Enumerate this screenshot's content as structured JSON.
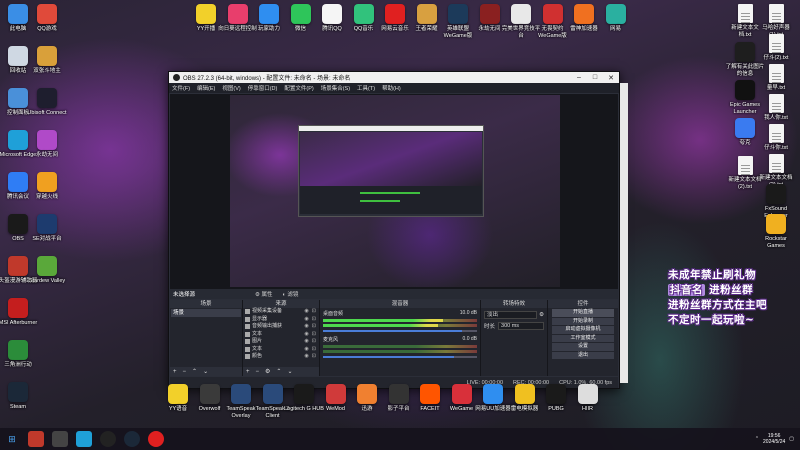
{
  "desktop": {
    "left_col": [
      {
        "label": "此电脑",
        "icon": "computer-icon",
        "color": "#3a8ee6"
      },
      {
        "label": "回收站",
        "icon": "recycle-bin-icon",
        "color": "#cfd8e3"
      },
      {
        "label": "控制面板",
        "icon": "control-panel-icon",
        "color": "#4a90d9"
      },
      {
        "label": "Microsoft Edge",
        "icon": "edge-icon",
        "color": "#1fa0d8"
      },
      {
        "label": "腾讯会议",
        "icon": "tencent-meeting-icon",
        "color": "#2f7df5"
      },
      {
        "label": "OBS",
        "icon": "obs-icon",
        "color": "#1a1a1a"
      },
      {
        "label": "头盔漫游辅助器",
        "icon": "helmet-icon",
        "color": "#c0392b"
      },
      {
        "label": "MSI Afterburner",
        "icon": "msi-icon",
        "color": "#c41e1e"
      },
      {
        "label": "三角洲行动",
        "icon": "delta-icon",
        "color": "#2b8c3a"
      },
      {
        "label": "Steam",
        "icon": "steam-icon",
        "color": "#1b2838"
      }
    ],
    "second_col": [
      {
        "label": "QQ游戏",
        "icon": "qq-game-icon",
        "color": "#e04a3a"
      },
      {
        "label": "双张斗地主",
        "icon": "doudizhu-icon",
        "color": "#d9a03a"
      },
      {
        "label": "Ubisoft Connect",
        "icon": "ubisoft-icon",
        "color": "#1e1e2e"
      },
      {
        "label": "永劫无间",
        "icon": "naraka-icon",
        "color": "#b04ac8"
      },
      {
        "label": "穿越火线",
        "icon": "crossfire-icon",
        "color": "#f0a020"
      },
      {
        "label": "SE对战平台",
        "icon": "se-platform-icon",
        "color": "#1d3b6e"
      },
      {
        "label": "Stardew Valley",
        "icon": "stardew-icon",
        "color": "#5aa83a"
      }
    ],
    "top_row": [
      {
        "label": "YY开播",
        "icon": "yy-icon",
        "color": "#f2d02a"
      },
      {
        "label": "向日葵远程控制",
        "icon": "sunflower-icon",
        "color": "#e83e6c"
      },
      {
        "label": "玩家助力",
        "icon": "player-help-icon",
        "color": "#2f8ef0"
      },
      {
        "label": "微信",
        "icon": "wechat-icon",
        "color": "#2ec55a"
      },
      {
        "label": "腾讯QQ",
        "icon": "qq-icon",
        "color": "#f5f5f5"
      },
      {
        "label": "QQ音乐",
        "icon": "qq-music-icon",
        "color": "#31c27c"
      },
      {
        "label": "网易云音乐",
        "icon": "netease-music-icon",
        "color": "#e02020"
      },
      {
        "label": "王者荣耀",
        "icon": "honor-of-kings-icon",
        "color": "#d8a040"
      },
      {
        "label": "英雄联盟WeGame版",
        "icon": "lol-icon",
        "color": "#1c3a5a"
      },
      {
        "label": "永劫无间",
        "icon": "naraka2-icon",
        "color": "#8a2020"
      },
      {
        "label": "完美世界竞技平台",
        "icon": "perfect-world-icon",
        "color": "#e8e8e8"
      },
      {
        "label": "无畏契约WeGame版",
        "icon": "valorant-icon",
        "color": "#d03030"
      },
      {
        "label": "雷神加速器",
        "icon": "leishen-icon",
        "color": "#f07020"
      },
      {
        "label": "网易",
        "icon": "netease-icon",
        "color": "#2ab0a0"
      }
    ],
    "right_col": [
      {
        "label": "新建文本文档.txt",
        "icon": "txt-file-icon"
      },
      {
        "label": "了解有关此图片的信息",
        "icon": "info-icon",
        "color": "#1e1e1e"
      },
      {
        "label": "Epic Games Launcher",
        "icon": "epic-icon",
        "color": "#111"
      },
      {
        "label": "夸克",
        "icon": "quark-icon",
        "color": "#3a7bf0"
      },
      {
        "label": "新建文本文档(2).txt",
        "icon": "txt-file-icon"
      }
    ],
    "far_right_col": [
      {
        "label": "马哈好声器(1).txt",
        "icon": "txt-file-icon"
      },
      {
        "label": "仔斗(2).txt",
        "icon": "txt-file-icon"
      },
      {
        "label": "量早.txt",
        "icon": "txt-file-icon"
      },
      {
        "label": "我人你.txt",
        "icon": "txt-file-icon"
      },
      {
        "label": "仔斗你.txt",
        "icon": "txt-file-icon"
      },
      {
        "label": "新建文本文档(2).txt",
        "icon": "txt-file-icon"
      },
      {
        "label": "FxSound Enhancer",
        "icon": "fxsound-icon",
        "color": "#1a1a1a"
      },
      {
        "label": "Rockstar Games",
        "icon": "rockstar-icon",
        "color": "#f0b020"
      }
    ],
    "bottom_row": [
      {
        "label": "YY语音",
        "icon": "yy-voice-icon",
        "color": "#f2d02a"
      },
      {
        "label": "Overwolf",
        "icon": "overwolf-icon",
        "color": "#3a3a3a"
      },
      {
        "label": "TeamSpeak Overlay",
        "icon": "teamspeak-overlay-icon",
        "color": "#2a4a7a"
      },
      {
        "label": "TeamSpeak 3 Client",
        "icon": "teamspeak-icon",
        "color": "#2a4a7a"
      },
      {
        "label": "Logitech G HUB",
        "icon": "ghub-icon",
        "color": "#1a1a1a"
      },
      {
        "label": "WeMod",
        "icon": "wemod-icon",
        "color": "#d03a3a"
      },
      {
        "label": "迅游",
        "icon": "xunyou-icon",
        "color": "#f08030"
      },
      {
        "label": "影子平台",
        "icon": "shadow-icon",
        "color": "#333"
      },
      {
        "label": "FACEIT",
        "icon": "faceit-icon",
        "color": "#ff5500"
      },
      {
        "label": "WeGame",
        "icon": "wegame-icon",
        "color": "#d8303a"
      },
      {
        "label": "网易UU加速器",
        "icon": "uu-icon",
        "color": "#2f8ef0"
      },
      {
        "label": "雷电模拟器",
        "icon": "ldplayer-icon",
        "color": "#f0c020"
      },
      {
        "label": "PUBG",
        "icon": "pubg-icon",
        "color": "#1a1a1a"
      },
      {
        "label": "HIIR",
        "icon": "hiir-icon",
        "color": "#ddd"
      }
    ]
  },
  "obs": {
    "title": "OBS 27.2.3 (64-bit, windows) - 配置文件: 未命名 - 场景: 未命名",
    "menu": [
      "文件(F)",
      "编辑(E)",
      "视图(V)",
      "停靠窗口(D)",
      "配置文件(P)",
      "场景集合(S)",
      "工具(T)",
      "帮助(H)"
    ],
    "status_bar": {
      "label": "未选择源",
      "props": "属性",
      "filters": "滤镜"
    },
    "docks": {
      "scenes": "场景",
      "sources": "来源",
      "mixer": "混音器",
      "transitions": "转场特效",
      "controls": "控件"
    },
    "scenes": [
      "场景"
    ],
    "sources": [
      "视频采集设备",
      "显示器",
      "音频输出捕获",
      "文本",
      "图片",
      "文本",
      "颜色"
    ],
    "mixer": [
      {
        "name": "桌面音频",
        "db": "10.0 dB",
        "level": 0.78,
        "volume": 0.9
      },
      {
        "name": "麦克风",
        "db": "0.0 dB",
        "level": 0.0,
        "volume": 0.85
      }
    ],
    "transition": {
      "type": "淡出",
      "duration_label": "时长",
      "duration": "300 ms"
    },
    "controls": [
      "开始直播",
      "开始录制",
      "启动虚拟摄像机",
      "工作室模式",
      "设置",
      "退出"
    ],
    "status": {
      "live": "LIVE: 00:00:00",
      "rec": "REC: 00:00:00",
      "cpu": "CPU: 1.0%, 60.00 fps"
    }
  },
  "promo": {
    "line1": "未成年禁止刷礼物",
    "tag": "抖音名",
    "line2": "进粉丝群",
    "line3": "进粉丝群方式在主吧",
    "line4": "不定时一起玩啦~"
  },
  "taskbar": {
    "time": "19:56",
    "date": "2024/5/24"
  }
}
